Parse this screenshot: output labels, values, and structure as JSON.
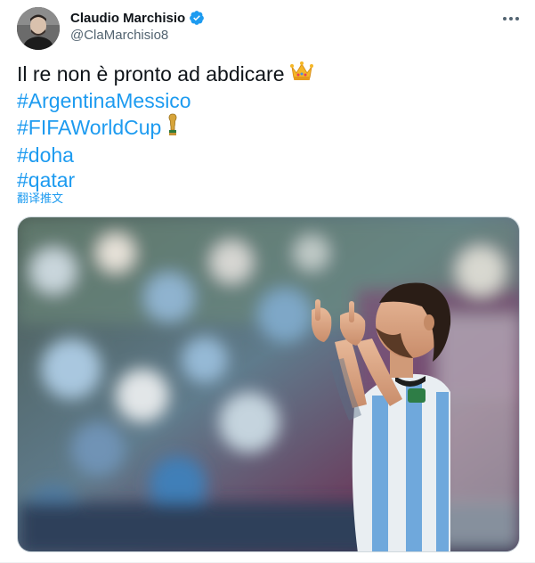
{
  "author": {
    "display_name": "Claudio Marchisio",
    "handle": "@ClaMarchisio8",
    "verified": true,
    "verified_color": "#1d9bf0"
  },
  "tweet": {
    "lines": [
      {
        "text": "Il re non è pronto ad abdicare",
        "type": "text",
        "emoji": "crown-emoji"
      },
      {
        "text": "#ArgentinaMessico",
        "type": "hashtag"
      },
      {
        "text": "#FIFAWorldCup",
        "type": "hashtag",
        "emoji": "world-cup-trophy-emoji"
      },
      {
        "text": "#doha",
        "type": "hashtag"
      },
      {
        "text": "#qatar",
        "type": "hashtag"
      }
    ],
    "translate_label": "翻译推文"
  },
  "media": {
    "kind": "photo",
    "icon": "photo-of-player-pointing-skyward"
  },
  "colors": {
    "link": "#1d9bf0",
    "text": "#0f1419",
    "secondary": "#536471"
  },
  "icons": {
    "more": "more-dots-icon",
    "verified": "verified-badge-icon"
  }
}
